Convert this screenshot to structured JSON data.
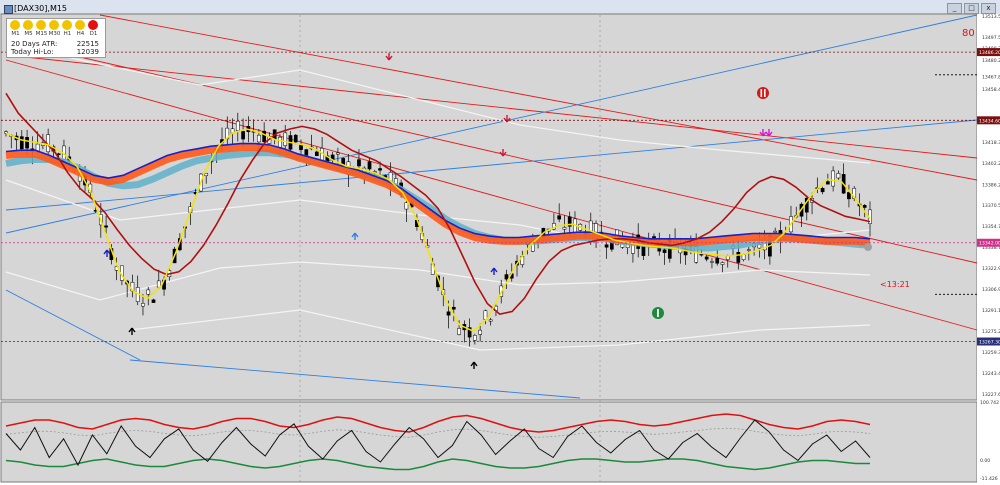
{
  "window": {
    "title": "[DAX30],M15",
    "btn_min": "_",
    "btn_max": "□",
    "btn_close": "x"
  },
  "panel": {
    "timeframes": [
      "M1",
      "M5",
      "M15",
      "M30",
      "H1",
      "H4",
      "D1"
    ],
    "tf_colors": [
      "#f2c300",
      "#f2c300",
      "#f2c300",
      "#f2c300",
      "#f2c300",
      "#f2c300",
      "#e31212"
    ],
    "atr_label": "20 Days ATR:",
    "atr_value": "22515",
    "hilo_label": "Today Hi-Lo:",
    "hilo_value": "12039"
  },
  "corner_value": "80",
  "countdown": "<13:21",
  "colors": {
    "candle": "#000000",
    "channel": "#e41a1a",
    "trendline": "#2f7fe0",
    "ma_fast": "#f5e400",
    "ma_slow": "#b01010",
    "ma_blue": "#1a20c8",
    "ribbon_red": "#ff5a1a",
    "ribbon_teal": "#5fb0c8",
    "osc_upper": "#e01010",
    "osc_lower": "#1a8a3a",
    "osc_main": "#111111"
  },
  "chart_data": [
    {
      "type": "line",
      "title": "",
      "price_labels": [
        "13513.50",
        "13497.50",
        "13489.20",
        "13485.60",
        "13480.20",
        "13467.80",
        "13458.40",
        "13434.60",
        "13418.30",
        "13402.20",
        "13386.20",
        "13370.50",
        "13354.70",
        "13338.70",
        "13322.90",
        "13306.90",
        "13291.10",
        "13275.20",
        "13267.30",
        "13259.30",
        "13243.40",
        "13227.60"
      ],
      "highlighted_levels": [
        {
          "label": "13486.20",
          "color": "#7a1010"
        },
        {
          "label": "13434.60",
          "color": "#7a1010"
        },
        {
          "label": "13342.00",
          "color": "#d0308a"
        },
        {
          "label": "13267.30",
          "color": "#2a2f7a"
        }
      ],
      "series": [
        {
          "values": [
            13455,
            13440,
            13430,
            13420,
            13410,
            13395,
            13383,
            13375,
            13365,
            13352,
            13340,
            13330,
            13322,
            13318,
            13320,
            13328,
            13340,
            13355,
            13372,
            13390,
            13405,
            13418,
            13425,
            13428,
            13430,
            13428,
            13424,
            13418,
            13412,
            13408,
            13404,
            13398,
            13392,
            13385,
            13378,
            13368,
            13352,
            13332,
            13312,
            13296,
            13288,
            13290,
            13300,
            13315,
            13328,
            13336,
            13340,
            13342,
            13344,
            13345,
            13345,
            13344,
            13342,
            13341,
            13340,
            13342,
            13345,
            13350,
            13358,
            13368,
            13380,
            13388,
            13392,
            13390,
            13384,
            13376,
            13370,
            13366,
            13362,
            13360,
            13358
          ]
        },
        {
          "values": [
            13425,
            13420,
            13418,
            13416,
            13410,
            13400,
            13380,
            13350,
            13320,
            13305,
            13300,
            13310,
            13335,
            13365,
            13395,
            13415,
            13425,
            13428,
            13425,
            13420,
            13418,
            13416,
            13412,
            13405,
            13400,
            13398,
            13395,
            13390,
            13380,
            13360,
            13330,
            13300,
            13280,
            13275,
            13285,
            13305,
            13325,
            13340,
            13350,
            13355,
            13356,
            13352,
            13348,
            13344,
            13342,
            13340,
            13339,
            13338,
            13336,
            13334,
            13333,
            13332,
            13333,
            13336,
            13340,
            13350,
            13365,
            13380,
            13390,
            13388,
            13375,
            13360
          ]
        },
        {
          "values": [
            13408,
            13409,
            13409,
            13405,
            13400,
            13395,
            13390,
            13388,
            13390,
            13395,
            13400,
            13405,
            13408,
            13410,
            13412,
            13413,
            13414,
            13414,
            13413,
            13410,
            13406,
            13403,
            13400,
            13397,
            13394,
            13390,
            13386,
            13380,
            13372,
            13364,
            13356,
            13350,
            13346,
            13344,
            13343,
            13343,
            13344,
            13345,
            13346,
            13347,
            13347,
            13346,
            13344,
            13343,
            13342,
            13342,
            13342,
            13342,
            13343,
            13344,
            13345,
            13346,
            13346,
            13346,
            13345,
            13344,
            13343,
            13343,
            13343,
            13342
          ]
        },
        {
          "values": [
            13402,
            13404,
            13405,
            13405,
            13403,
            13398,
            13392,
            13387,
            13385,
            13386,
            13390,
            13395,
            13400,
            13404,
            13406,
            13408,
            13409,
            13410,
            13410,
            13409,
            13407,
            13404,
            13401,
            13398,
            13395,
            13392,
            13388,
            13382,
            13375,
            13368,
            13360,
            13354,
            13349,
            13346,
            13344,
            13343,
            13343,
            13344,
            13345,
            13346,
            13346,
            13345,
            13343,
            13342,
            13341,
            13340,
            13339,
            13338,
            13338,
            13339,
            13340,
            13342,
            13344,
            13345,
            13345,
            13344,
            13343,
            13342,
            13341,
            13340
          ]
        }
      ]
    },
    {
      "type": "line",
      "title": "",
      "price_labels": [
        "100.742",
        "0.00",
        "-11.426"
      ],
      "series": [
        {
          "values": [
            72,
            76,
            80,
            80,
            76,
            70,
            68,
            74,
            80,
            82,
            80,
            74,
            70,
            68,
            72,
            78,
            82,
            82,
            78,
            72,
            70,
            74,
            80,
            84,
            82,
            76,
            70,
            66,
            64,
            70,
            78,
            84,
            86,
            82,
            76,
            70,
            66,
            64,
            66,
            70,
            74,
            78,
            80,
            78,
            74,
            72,
            74,
            78,
            82,
            86,
            88,
            86,
            80,
            74,
            70,
            68,
            72,
            78,
            80,
            78,
            74
          ]
        },
        {
          "values": [
            26,
            24,
            20,
            18,
            18,
            22,
            26,
            28,
            24,
            20,
            18,
            18,
            22,
            26,
            28,
            26,
            22,
            18,
            16,
            18,
            22,
            26,
            28,
            26,
            22,
            18,
            16,
            14,
            14,
            18,
            24,
            28,
            26,
            22,
            18,
            16,
            16,
            18,
            22,
            26,
            28,
            28,
            26,
            24,
            24,
            26,
            28,
            28,
            26,
            22,
            18,
            16,
            14,
            16,
            20,
            24,
            26,
            26,
            24,
            22,
            22
          ]
        },
        {
          "values": [
            62,
            40,
            70,
            30,
            55,
            20,
            60,
            35,
            72,
            45,
            30,
            55,
            68,
            40,
            25,
            50,
            70,
            48,
            32,
            60,
            75,
            45,
            28,
            52,
            66,
            38,
            24,
            48,
            70,
            55,
            30,
            46,
            78,
            60,
            34,
            52,
            68,
            42,
            30,
            58,
            72,
            50,
            36,
            54,
            66,
            40,
            28,
            50,
            62,
            44,
            30,
            56,
            80,
            64,
            40,
            26,
            48,
            60,
            38,
            52,
            30
          ]
        }
      ]
    }
  ]
}
